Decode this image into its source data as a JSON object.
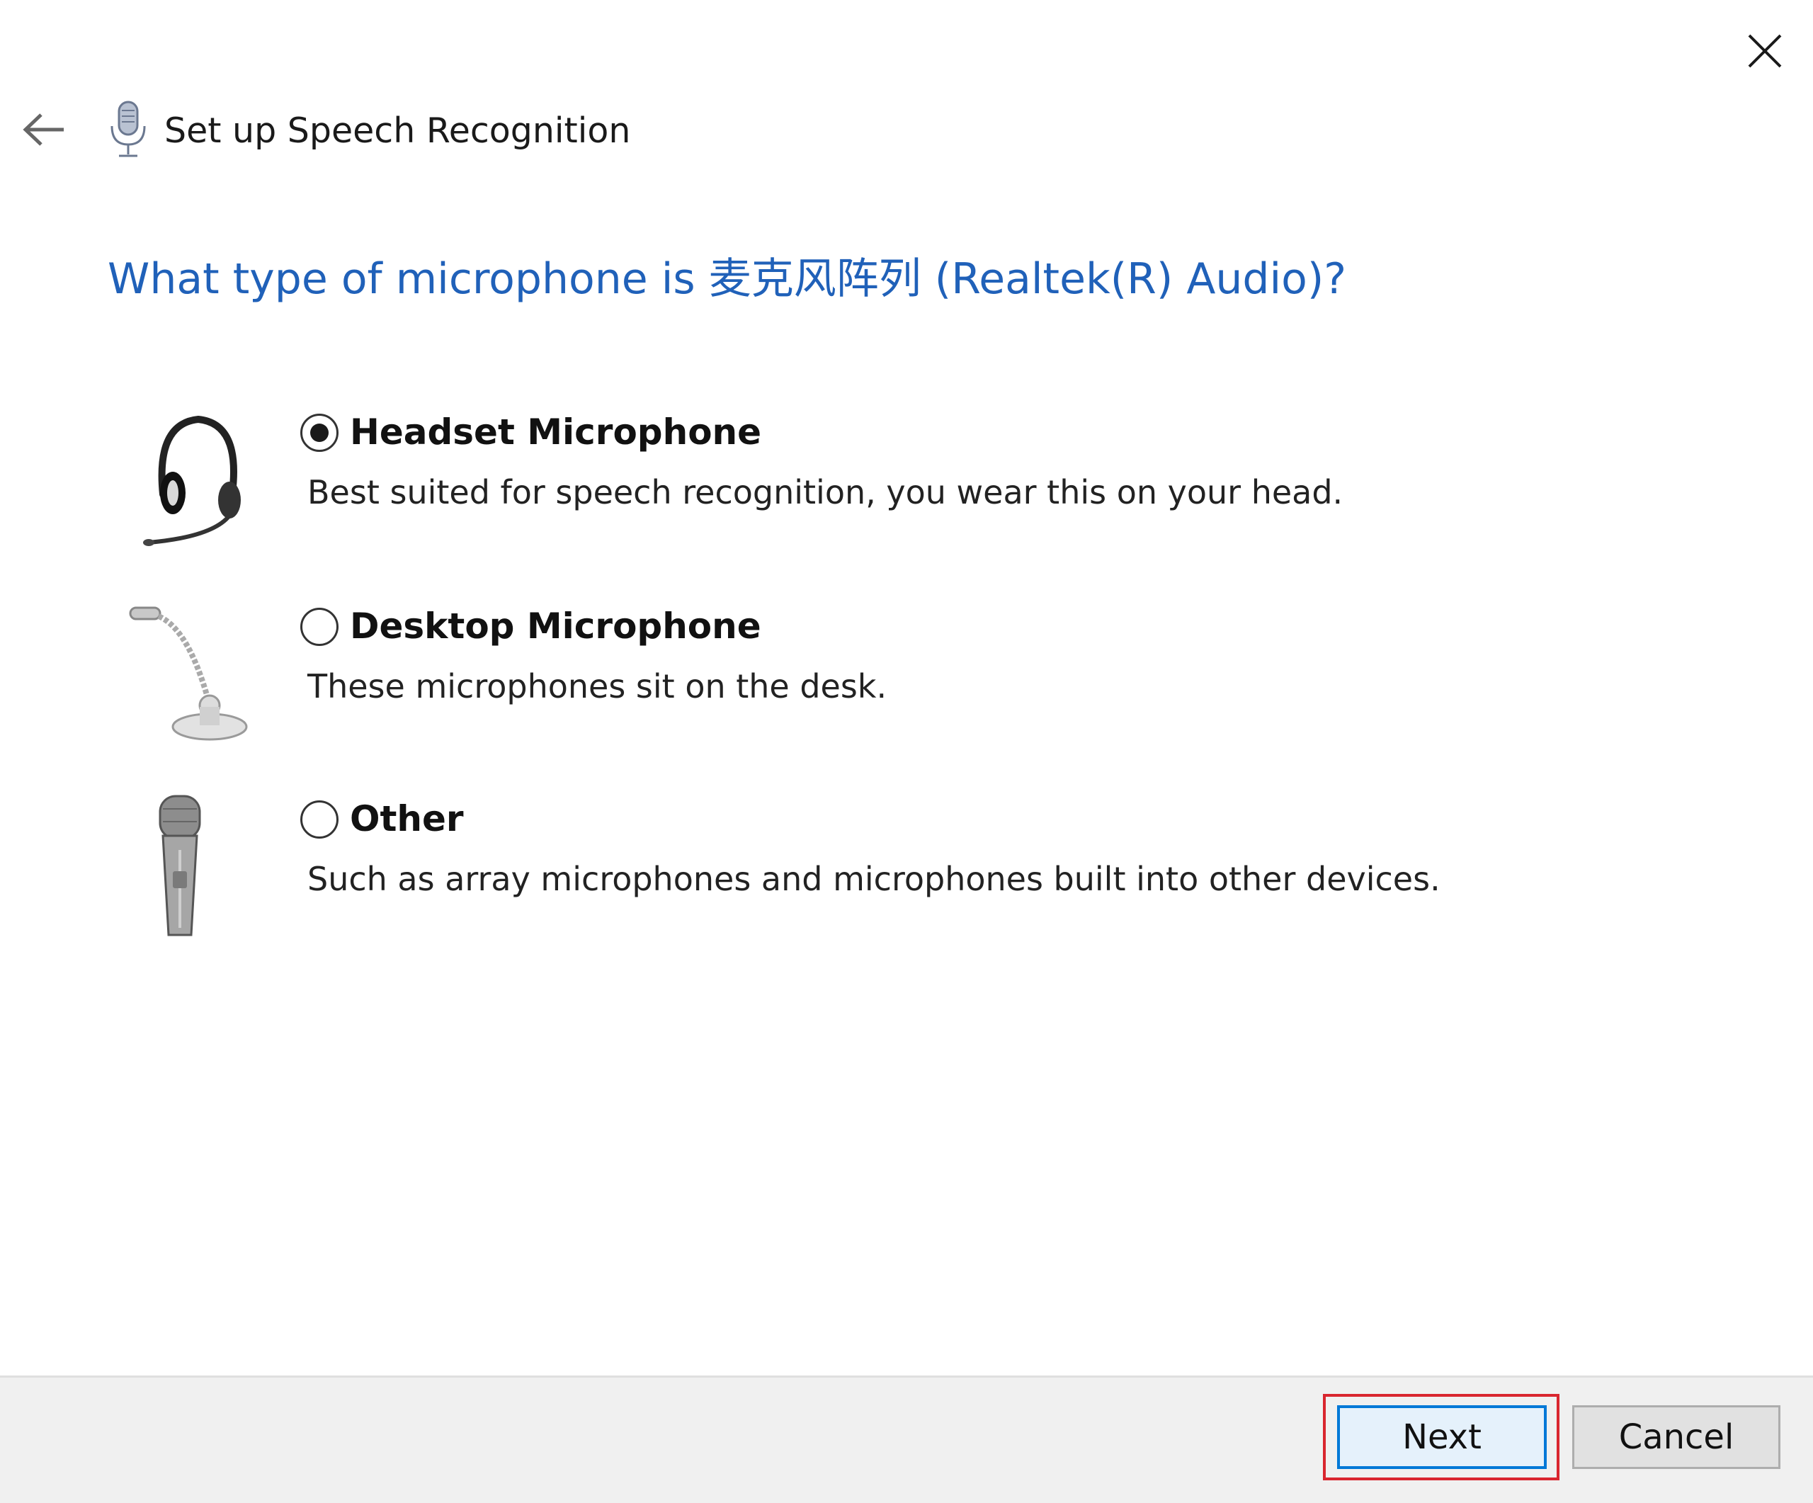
{
  "window": {
    "title": "Set up Speech Recognition",
    "back_icon": "back-arrow-icon",
    "close_icon": "close-icon",
    "title_icon": "microphone-icon"
  },
  "main": {
    "question": "What type of microphone is 麦克风阵列 (Realtek(R) Audio)?",
    "question_color": "#2061b9"
  },
  "options": [
    {
      "label": "Headset Microphone",
      "description": "Best suited for speech recognition, you wear this on your head.",
      "selected": true,
      "icon": "headset-microphone-icon"
    },
    {
      "label": "Desktop Microphone",
      "description": "These microphones sit on the desk.",
      "selected": false,
      "icon": "desktop-microphone-icon"
    },
    {
      "label": "Other",
      "description": "Such as array microphones and microphones built into other devices.",
      "selected": false,
      "icon": "handheld-microphone-icon"
    }
  ],
  "footer": {
    "next_label": "Next",
    "cancel_label": "Cancel",
    "highlight_color": "#d9262f"
  }
}
